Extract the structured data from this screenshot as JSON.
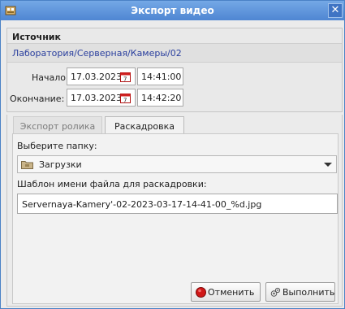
{
  "window": {
    "title": "Экспорт видео",
    "close_glyph": "✕"
  },
  "source": {
    "heading": "Источник",
    "path": "Лаборатория/Серверная/Камеры/02",
    "start_label": "Начало:",
    "start_date": "17.03.2023",
    "start_time": "14:41:00",
    "end_label": "Окончание:",
    "end_date": "17.03.2023",
    "end_time": "14:42:20"
  },
  "tabs": [
    {
      "label": "Экспорт ролика",
      "active": false
    },
    {
      "label": "Раскадровка",
      "active": true
    }
  ],
  "storyboard": {
    "folder_label": "Выберите папку:",
    "folder_value": "Загрузки",
    "template_label": "Шаблон имени файла для раскадровки:",
    "template_value": "Servernaya-Kamery'-02-2023-03-17-14-41-00_%d.jpg"
  },
  "buttons": {
    "cancel": "Отменить",
    "run": "Выполнить"
  },
  "icons": {
    "app": "film-icon",
    "calendar": "calendar-icon",
    "folder": "folder-icon",
    "cancel": "record-stop-icon",
    "run": "gears-icon"
  },
  "colors": {
    "titlebar": "#5a90d8",
    "path_text": "#2a3f9e",
    "cancel_dot": "#d01818"
  }
}
